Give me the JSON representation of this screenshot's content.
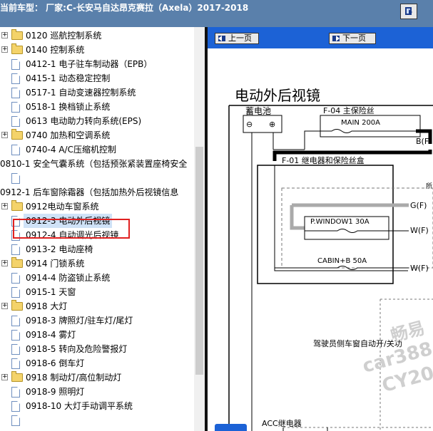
{
  "window": {
    "title": "当前车型：  厂家:C-长安马自达昂克赛拉（Axela）2017-2018"
  },
  "tree": {
    "items": [
      {
        "label": "0120 巡航控制系统",
        "kind": "folder",
        "expand": "+"
      },
      {
        "label": "0140 控制系统",
        "kind": "folder",
        "expand": "+"
      },
      {
        "label": "0412-1 电子驻车制动器（EPB）",
        "kind": "doc"
      },
      {
        "label": "0415-1 动态稳定控制",
        "kind": "doc"
      },
      {
        "label": "0517-1 自动变速器控制系统",
        "kind": "doc"
      },
      {
        "label": "0518-1 换档锁止系统",
        "kind": "doc"
      },
      {
        "label": "0613 电动助力转向系统(EPS)",
        "kind": "doc"
      },
      {
        "label": "0740 加热和空调系统",
        "kind": "folder",
        "expand": "+"
      },
      {
        "label": "0740-4 A/C压缩机控制",
        "kind": "doc"
      },
      {
        "label": "0810-1 安全气囊系统（包括预张紧装置座椅安全",
        "kind": "text"
      },
      {
        "label": "",
        "kind": "doc"
      },
      {
        "label": "0912-1 后车窗除霜器（包括加热外后视镜信息",
        "kind": "text"
      },
      {
        "label": "0912电动车窗系统",
        "kind": "folder",
        "expand": "+"
      },
      {
        "label": "0912-3 电动外后视镜",
        "kind": "doc",
        "selected": true
      },
      {
        "label": "0912-4 自动调光后视镜",
        "kind": "doc"
      },
      {
        "label": "0913-2 电动座椅",
        "kind": "doc"
      },
      {
        "label": "0914 门锁系统",
        "kind": "folder",
        "expand": "+"
      },
      {
        "label": "0914-4 防盗锁止系统",
        "kind": "doc"
      },
      {
        "label": "0915-1 天窗",
        "kind": "doc"
      },
      {
        "label": "0918 大灯",
        "kind": "folder",
        "expand": "+"
      },
      {
        "label": "0918-3 牌照灯/驻车灯/尾灯",
        "kind": "doc"
      },
      {
        "label": "0918-4 雾灯",
        "kind": "doc"
      },
      {
        "label": "0918-5 转向及危险警报灯",
        "kind": "doc"
      },
      {
        "label": "0918-6 倒车灯",
        "kind": "doc"
      },
      {
        "label": "0918 制动灯/高位制动灯",
        "kind": "folder",
        "expand": "+"
      },
      {
        "label": "0918-9 照明灯",
        "kind": "doc"
      },
      {
        "label": "0918-10 大灯手动调平系统",
        "kind": "doc"
      },
      {
        "label": "",
        "kind": "doc"
      }
    ]
  },
  "nav": {
    "prev_label": "上一页",
    "next_label": "下一页"
  },
  "document": {
    "title": "电动外后视镜",
    "battery_label": "蓄电池",
    "battery_minus": "⊖",
    "battery_plus": "⊕",
    "fuse_main_block": "F-04  主保险丝",
    "fuse_main": "MAIN 200A",
    "relay_box": "F-01  继电器和保险丝盒",
    "fuse_window": "P.WINDOW1 30A",
    "fuse_cabin": "CABIN+B 50A",
    "term_b": "B(F",
    "term_g": "G(F)",
    "term_w1": "W(F)",
    "term_w2": "W(F)",
    "partial_label": "所",
    "driver_switch": "驾驶员侧车窗自动开/关功",
    "acc_relay": "ACC继电器"
  },
  "watermark": {
    "line1": "畅易",
    "line2": "car388.",
    "line3": "CY20"
  },
  "colors": {
    "title_bar": "#5a80ab",
    "nav_bar": "#1c62d6",
    "selection_outline": "#e02020",
    "selected_bg": "#cfe2f7"
  }
}
